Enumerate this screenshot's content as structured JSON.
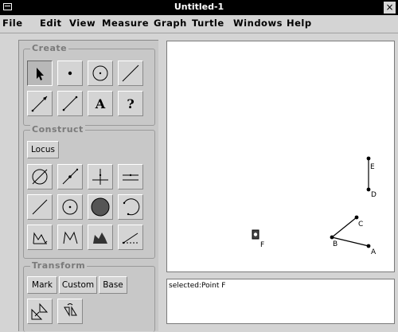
{
  "window": {
    "title": "Untitled-1",
    "close_glyph": "×"
  },
  "menubar": {
    "items": [
      "File",
      "Edit",
      "View",
      "Measure",
      "Graph",
      "Turtle",
      "Windows",
      "Help"
    ]
  },
  "panel": {
    "create": {
      "label": "Create",
      "tools": [
        "arrow-select-icon",
        "point-icon",
        "circle-icon",
        "line-icon",
        "ray-icon",
        "segment-icon",
        "text-icon",
        "help-icon"
      ],
      "text_glyph": "A",
      "help_glyph": "?"
    },
    "construct": {
      "label": "Construct",
      "locus_label": "Locus",
      "tools": [
        "intersection-icon",
        "midpoint-icon",
        "perpendicular-icon",
        "parallel-icon",
        "segment-line-icon",
        "circle-center-icon",
        "filled-circle-icon",
        "arc-icon",
        "polygon-icon",
        "polygon-alt-icon",
        "filled-polygon-icon",
        "bisector-icon"
      ]
    },
    "transform": {
      "label": "Transform",
      "buttons": [
        "Mark",
        "Custom",
        "Base"
      ],
      "tools": [
        "dilate-icon",
        "rotate-icon"
      ]
    }
  },
  "canvas": {
    "points": [
      {
        "label": "E"
      },
      {
        "label": "D"
      },
      {
        "label": "C"
      },
      {
        "label": "B"
      },
      {
        "label": "A"
      },
      {
        "label": "F"
      }
    ]
  },
  "status": {
    "text": "selected:Point F"
  }
}
